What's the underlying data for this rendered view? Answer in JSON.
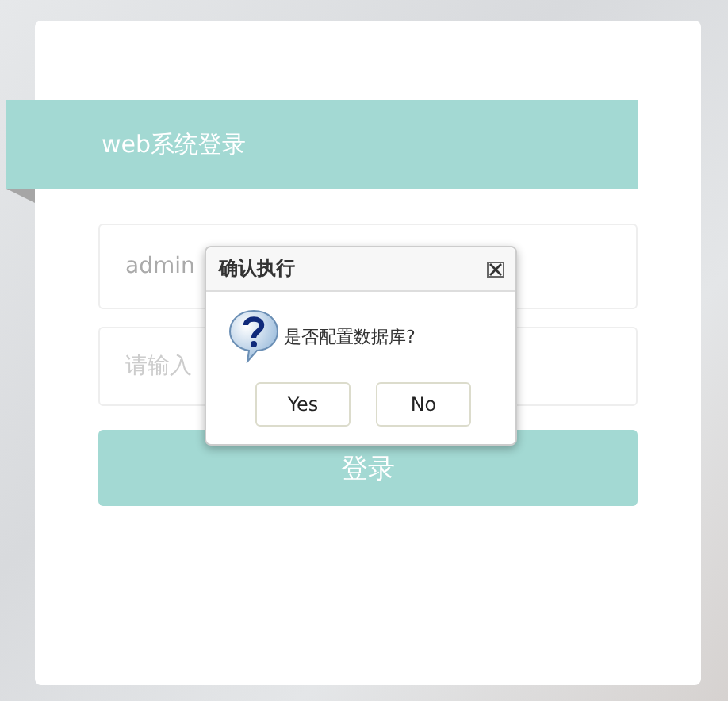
{
  "header": {
    "title": "web系统登录"
  },
  "form": {
    "username": {
      "value": "admin"
    },
    "password": {
      "placeholder": "请输入"
    },
    "submit": "登录"
  },
  "dialog": {
    "title": "确认执行",
    "message": "是否配置数据库?",
    "buttons": [
      "Yes",
      "No"
    ]
  }
}
